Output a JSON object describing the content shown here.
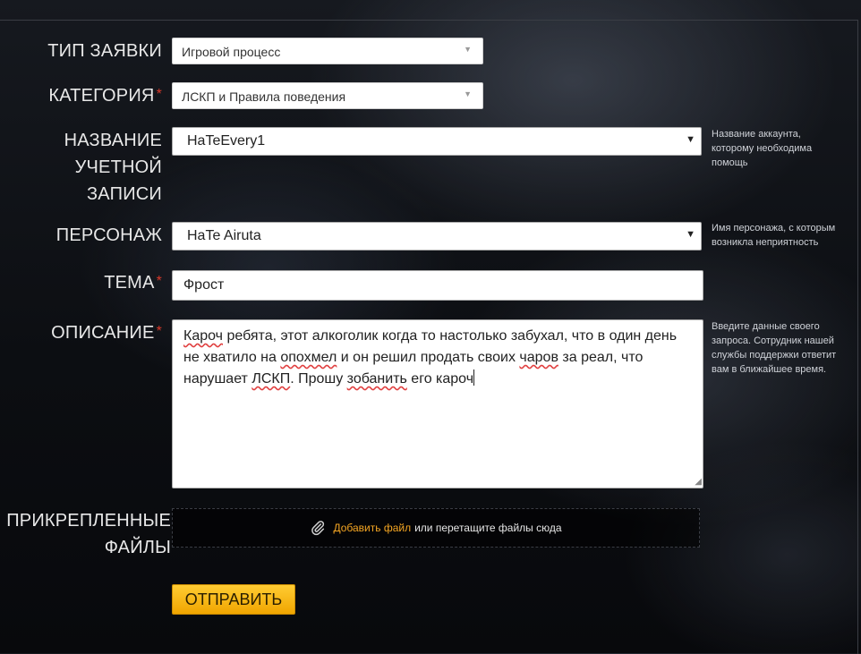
{
  "form": {
    "request_type": {
      "label": "ТИП ЗАЯВКИ",
      "value": "Игровой процесс"
    },
    "category": {
      "label": "КАТЕГОРИЯ",
      "required_mark": "*",
      "value": "ЛСКП и Правила поведения"
    },
    "account": {
      "label_lines": [
        "НАЗВАНИЕ",
        "УЧЕТНОЙ",
        "ЗАПИСИ"
      ],
      "value": "HaTeEvery1",
      "hint": "Название аккаунта, которому необходима помощь"
    },
    "character": {
      "label": "ПЕРСОНАЖ",
      "value": "HaTe Airuta",
      "hint": "Имя персонажа, с которым возникла неприятность"
    },
    "subject": {
      "label": "ТЕМА",
      "required_mark": "*",
      "value": "Фрост"
    },
    "description": {
      "label": "ОПИСАНИЕ",
      "required_mark": "*",
      "segments": [
        "Кароч",
        " ребята, этот алкоголик когда то настолько забухал, что в один день не хватило на ",
        "опохмел",
        " и он решил продать своих ",
        "чаров",
        " за реал, что нарушает ",
        "ЛСКП",
        ". Прошу ",
        "зобанить",
        " его кароч"
      ],
      "hint": "Введите данные своего запроса. Сотрудник нашей службы поддержки ответит вам в ближайшее время."
    },
    "attachments": {
      "label_lines": [
        "ПРИКРЕПЛЕННЫЕ",
        "ФАЙЛЫ"
      ],
      "add_link": "Добавить файл",
      "drop_text": "или перетащите файлы сюда"
    },
    "submit_label": "ОТПРАВИТЬ"
  },
  "colors": {
    "accent": "#f5a623",
    "required": "#d9392b",
    "button": "#ffc11f"
  }
}
